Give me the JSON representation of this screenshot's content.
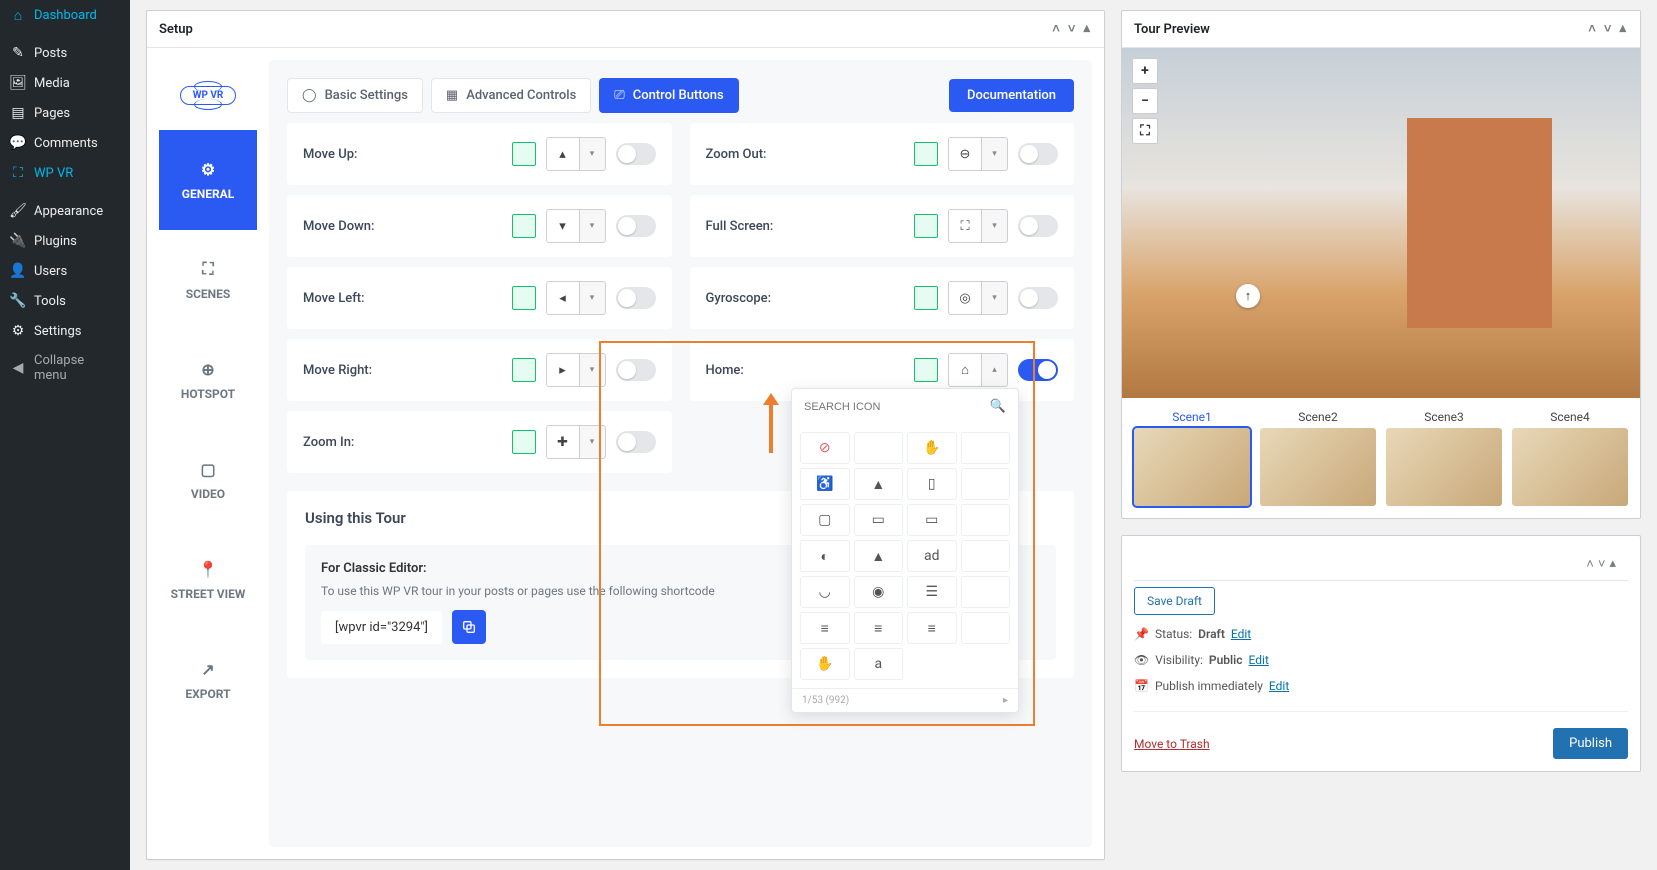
{
  "sidebar": {
    "items": [
      {
        "label": "Dashboard",
        "icon": "⌂"
      },
      {
        "label": "Posts",
        "icon": "✎"
      },
      {
        "label": "Media",
        "icon": "🖼"
      },
      {
        "label": "Pages",
        "icon": "▤"
      },
      {
        "label": "Comments",
        "icon": "💬"
      },
      {
        "label": "WP VR",
        "icon": "⛶"
      },
      {
        "label": "Appearance",
        "icon": "🖌"
      },
      {
        "label": "Plugins",
        "icon": "🔌"
      },
      {
        "label": "Users",
        "icon": "👤"
      },
      {
        "label": "Tools",
        "icon": "🔧"
      },
      {
        "label": "Settings",
        "icon": "⚙"
      },
      {
        "label": "Collapse menu",
        "icon": "◀"
      }
    ]
  },
  "setup": {
    "title": "Setup",
    "logo_text": "WP VR",
    "vtabs": [
      {
        "label": "GENERAL",
        "icon": "⚙"
      },
      {
        "label": "SCENES",
        "icon": "⛶"
      },
      {
        "label": "HOTSPOT",
        "icon": "⊕"
      },
      {
        "label": "VIDEO",
        "icon": "▢"
      },
      {
        "label": "STREET VIEW",
        "icon": "📍"
      },
      {
        "label": "EXPORT",
        "icon": "↗"
      }
    ],
    "tabs": {
      "basic": "Basic Settings",
      "advanced": "Advanced Controls",
      "control": "Control Buttons"
    },
    "doc_btn": "Documentation",
    "controls_left": [
      {
        "label": "Move Up:",
        "icon": "▴"
      },
      {
        "label": "Move Down:",
        "icon": "▾"
      },
      {
        "label": "Move Left:",
        "icon": "◂"
      },
      {
        "label": "Move Right:",
        "icon": "▸"
      },
      {
        "label": "Zoom In:",
        "icon": "✚"
      }
    ],
    "controls_right": [
      {
        "label": "Zoom Out:",
        "icon": "⊖"
      },
      {
        "label": "Full Screen:",
        "icon": "⛶"
      },
      {
        "label": "Gyroscope:",
        "icon": "◎"
      },
      {
        "label": "Home:",
        "icon": "⌂"
      }
    ],
    "using": {
      "heading": "Using this Tour",
      "classic_heading": "For Classic Editor:",
      "classic_desc": "To use this WP VR tour in your posts or pages use the following shortcode",
      "shortcode": "[wpvr id=\"3294\"]"
    },
    "icon_picker": {
      "placeholder": "SEARCH ICON",
      "footer": "1/53 (992)"
    }
  },
  "preview": {
    "title": "Tour Preview",
    "scenes": [
      "Scene1",
      "Scene2",
      "Scene3",
      "Scene4"
    ]
  },
  "publish": {
    "save_draft": "Save Draft",
    "status_label": "Status:",
    "status_value": "Draft",
    "visibility_label": "Visibility:",
    "visibility_value": "Public",
    "schedule_label": "Publish immediately",
    "edit": "Edit",
    "trash": "Move to Trash",
    "publish_btn": "Publish"
  }
}
